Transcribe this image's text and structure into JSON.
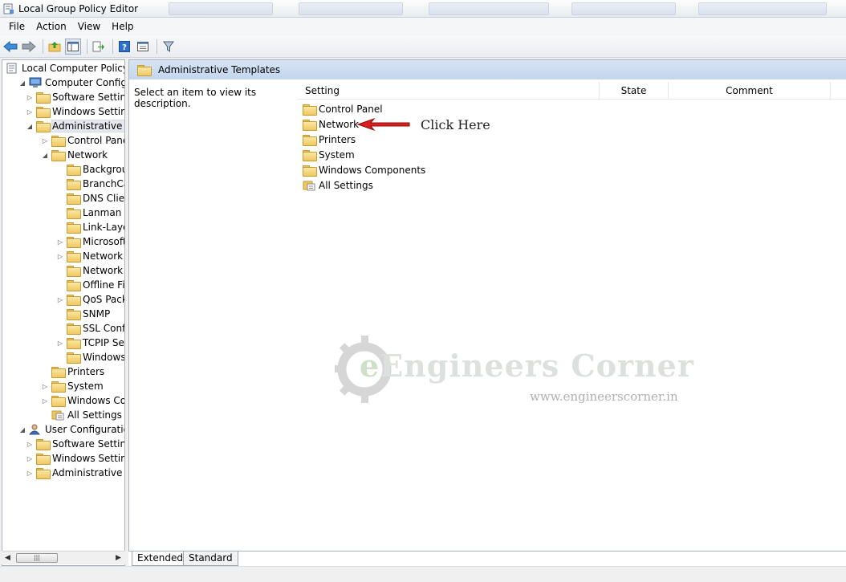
{
  "window": {
    "title": "Local Group Policy Editor"
  },
  "menu": [
    "File",
    "Action",
    "View",
    "Help"
  ],
  "tree": {
    "items": [
      {
        "label": "Local Computer Policy",
        "icon": "policy-doc-icon",
        "depth": 0,
        "expander": ""
      },
      {
        "label": "Computer Configura",
        "icon": "computer-icon",
        "depth": 1,
        "expander": "down"
      },
      {
        "label": "Software Settings",
        "icon": "folder-icon",
        "depth": 2,
        "expander": "right"
      },
      {
        "label": "Windows Setting",
        "icon": "folder-icon",
        "depth": 2,
        "expander": "right"
      },
      {
        "label": "Administrative Te",
        "icon": "folder-icon",
        "depth": 2,
        "expander": "down",
        "selected": true
      },
      {
        "label": "Control Panel",
        "icon": "folder-icon",
        "depth": 3,
        "expander": "right"
      },
      {
        "label": "Network",
        "icon": "folder-icon",
        "depth": 3,
        "expander": "down"
      },
      {
        "label": "Backgrou",
        "icon": "folder-icon",
        "depth": 4,
        "expander": ""
      },
      {
        "label": "BranchCa",
        "icon": "folder-icon",
        "depth": 4,
        "expander": ""
      },
      {
        "label": "DNS Clien",
        "icon": "folder-icon",
        "depth": 4,
        "expander": ""
      },
      {
        "label": "Lanman S",
        "icon": "folder-icon",
        "depth": 4,
        "expander": ""
      },
      {
        "label": "Link-Laye",
        "icon": "folder-icon",
        "depth": 4,
        "expander": ""
      },
      {
        "label": "Microsoft",
        "icon": "folder-icon",
        "depth": 4,
        "expander": "right"
      },
      {
        "label": "Network (",
        "icon": "folder-icon",
        "depth": 4,
        "expander": "right"
      },
      {
        "label": "Network (",
        "icon": "folder-icon",
        "depth": 4,
        "expander": ""
      },
      {
        "label": "Offline Fil",
        "icon": "folder-icon",
        "depth": 4,
        "expander": ""
      },
      {
        "label": "QoS Packe",
        "icon": "folder-icon",
        "depth": 4,
        "expander": "right"
      },
      {
        "label": "SNMP",
        "icon": "folder-icon",
        "depth": 4,
        "expander": ""
      },
      {
        "label": "SSL Confi",
        "icon": "folder-icon",
        "depth": 4,
        "expander": ""
      },
      {
        "label": "TCPIP Set",
        "icon": "folder-icon",
        "depth": 4,
        "expander": "right"
      },
      {
        "label": "Windows",
        "icon": "folder-icon",
        "depth": 4,
        "expander": ""
      },
      {
        "label": "Printers",
        "icon": "folder-icon",
        "depth": 3,
        "expander": ""
      },
      {
        "label": "System",
        "icon": "folder-icon",
        "depth": 3,
        "expander": "right"
      },
      {
        "label": "Windows Cor",
        "icon": "folder-icon",
        "depth": 3,
        "expander": "right"
      },
      {
        "label": "All Settings",
        "icon": "all-settings-icon",
        "depth": 3,
        "expander": ""
      },
      {
        "label": "User Configuration",
        "icon": "user-icon",
        "depth": 1,
        "expander": "down"
      },
      {
        "label": "Software Settings",
        "icon": "folder-icon",
        "depth": 2,
        "expander": "right"
      },
      {
        "label": "Windows Setting",
        "icon": "folder-icon",
        "depth": 2,
        "expander": "right"
      },
      {
        "label": "Administrative Te",
        "icon": "folder-icon",
        "depth": 2,
        "expander": "right"
      }
    ]
  },
  "right": {
    "header": "Administrative Templates",
    "description": "Select an item to view its description.",
    "columns": {
      "setting": "Setting",
      "state": "State",
      "comment": "Comment"
    },
    "items": [
      {
        "label": "Control Panel",
        "icon": "folder-icon"
      },
      {
        "label": "Network",
        "icon": "folder-icon"
      },
      {
        "label": "Printers",
        "icon": "folder-icon"
      },
      {
        "label": "System",
        "icon": "folder-icon"
      },
      {
        "label": "Windows Components",
        "icon": "folder-icon"
      },
      {
        "label": "All Settings",
        "icon": "all-settings-icon"
      }
    ]
  },
  "annotation": {
    "text": "Click Here",
    "arrow_color": "#d81e1e"
  },
  "watermark": {
    "brand_e": "e",
    "brand_rest": "Engineers Corner",
    "url": "www.engineerscorner.in"
  },
  "view_tabs": {
    "extended": "Extended",
    "standard": "Standard"
  },
  "colors": {
    "header_band": "#c9daf0",
    "border": "#a9b3bf",
    "folder": "#efc861"
  }
}
